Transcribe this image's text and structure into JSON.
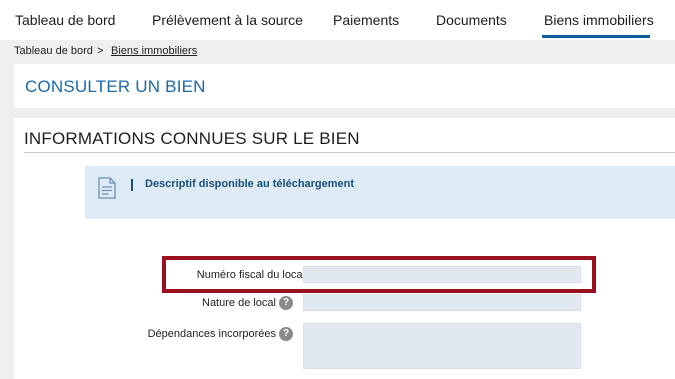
{
  "nav": {
    "tabs": [
      {
        "label": "Tableau de bord"
      },
      {
        "label": "Prélèvement à la source"
      },
      {
        "label": "Paiements"
      },
      {
        "label": "Documents"
      },
      {
        "label": "Biens immobiliers"
      }
    ],
    "active_tab": "Biens immobiliers"
  },
  "breadcrumb": {
    "home": "Tableau de bord",
    "separator": ">",
    "current": "Biens immobiliers"
  },
  "page": {
    "title": "CONSULTER UN BIEN"
  },
  "section": {
    "title": "INFORMATIONS CONNUES SUR LE BIEN",
    "info": {
      "icon": "document-icon",
      "text": "Descriptif disponible au téléchargement"
    },
    "fields": [
      {
        "label": "Numéro fiscal du local",
        "value": "",
        "help": false
      },
      {
        "label": "Nature de local",
        "value": "",
        "help": true
      },
      {
        "label": "Dépendances incorporées",
        "value": "",
        "help": true
      }
    ]
  },
  "help_glyph": "?",
  "colors": {
    "accent": "#1a6aa8",
    "info_bg": "#dcebf5",
    "highlight": "#9a1020"
  }
}
